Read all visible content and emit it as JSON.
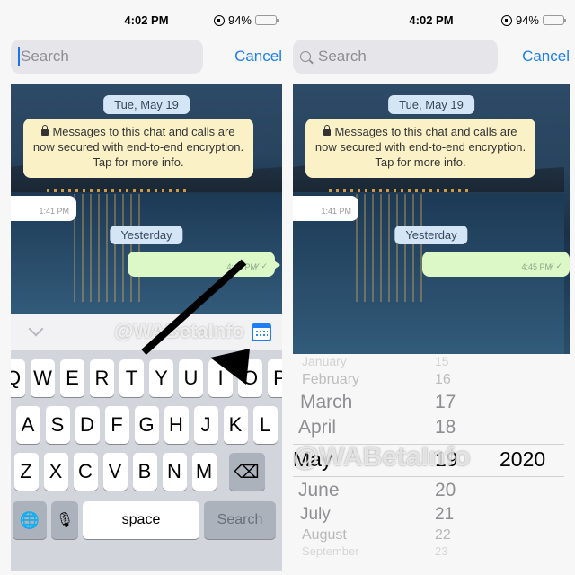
{
  "status_bar": {
    "time": "4:02 PM",
    "battery": "94%",
    "battery_level_percent": 94
  },
  "search": {
    "placeholder": "Search",
    "cancel_label": "Cancel"
  },
  "chat": {
    "date_top": "Tue, May 19",
    "system_message": "Messages to this chat and calls are now secured with end-to-end encryption. Tap for more info.",
    "incoming_time": "1:41 PM",
    "date_yesterday": "Yesterday",
    "outgoing_time": "4:45 PM",
    "outgoing_ticks": "✓✓"
  },
  "watermark": "@WABetaInfo",
  "keyboard": {
    "row1": [
      "Q",
      "W",
      "E",
      "R",
      "T",
      "Y",
      "U",
      "I",
      "O",
      "P"
    ],
    "row2": [
      "A",
      "S",
      "D",
      "F",
      "G",
      "H",
      "J",
      "K",
      "L"
    ],
    "row3": [
      "Z",
      "X",
      "C",
      "V",
      "B",
      "N",
      "M"
    ],
    "space_label": "space",
    "search_label": "Search",
    "backspace_icon": "⌫",
    "globe_icon": "🌐",
    "mic_icon": "🎙"
  },
  "date_picker": {
    "rows": [
      {
        "month": "January",
        "day": "15",
        "year": ""
      },
      {
        "month": "February",
        "day": "16",
        "year": ""
      },
      {
        "month": "March",
        "day": "17",
        "year": ""
      },
      {
        "month": "April",
        "day": "18",
        "year": ""
      },
      {
        "month": "May",
        "day": "19",
        "year": "2020",
        "selected": true
      },
      {
        "month": "June",
        "day": "20",
        "year": ""
      },
      {
        "month": "July",
        "day": "21",
        "year": ""
      },
      {
        "month": "August",
        "day": "22",
        "year": ""
      },
      {
        "month": "September",
        "day": "23",
        "year": ""
      }
    ]
  }
}
